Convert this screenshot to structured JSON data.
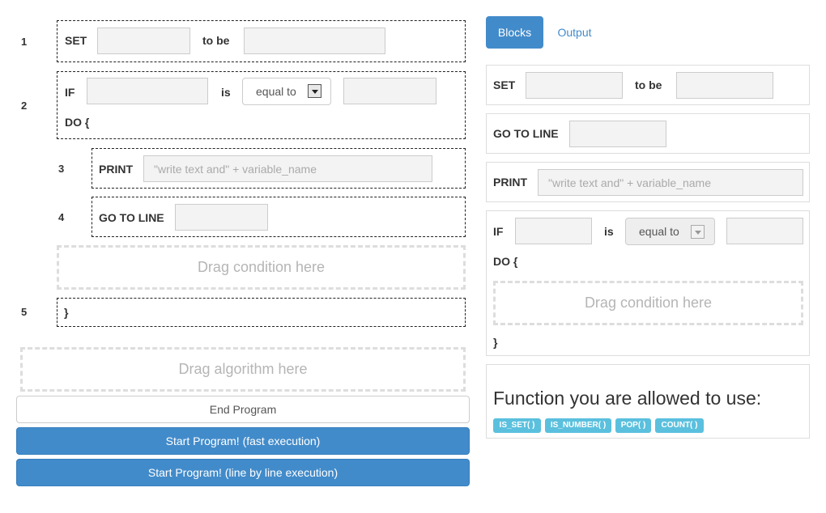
{
  "program": {
    "line_numbers": [
      "1",
      "2",
      "3",
      "4",
      "5"
    ],
    "set_block": {
      "keyword": "SET",
      "connector": "to be"
    },
    "if_block": {
      "keyword": "IF",
      "connector": "is",
      "operator": "equal to",
      "do_label": "DO {",
      "close": "}"
    },
    "print_block": {
      "keyword": "PRINT",
      "placeholder": "\"write text and\" + variable_name"
    },
    "goto_block": {
      "keyword": "GO TO LINE"
    },
    "condition_drop": "Drag condition here",
    "algorithm_drop": "Drag algorithm here",
    "buttons": {
      "end": "End Program",
      "start_fast": "Start Program! (fast execution)",
      "start_line": "Start Program! (line by line execution)"
    }
  },
  "tabs": {
    "blocks": "Blocks",
    "output": "Output"
  },
  "palette": {
    "set_block": {
      "keyword": "SET",
      "connector": "to be"
    },
    "goto_block": {
      "keyword": "GO TO LINE"
    },
    "print_block": {
      "keyword": "PRINT",
      "placeholder": "\"write text and\" + variable_name"
    },
    "if_block": {
      "keyword": "IF",
      "connector": "is",
      "operator": "equal to",
      "do_label": "DO {",
      "close": "}",
      "condition_drop": "Drag condition here"
    }
  },
  "functions": {
    "title": "Function you are allowed to use:",
    "items": [
      "IS_SET( )",
      "IS_NUMBER( )",
      "POP( )",
      "COUNT( )"
    ]
  },
  "colors": {
    "primary": "#428bca",
    "badge": "#5bc0de",
    "dropzone_border": "#dddddd"
  }
}
